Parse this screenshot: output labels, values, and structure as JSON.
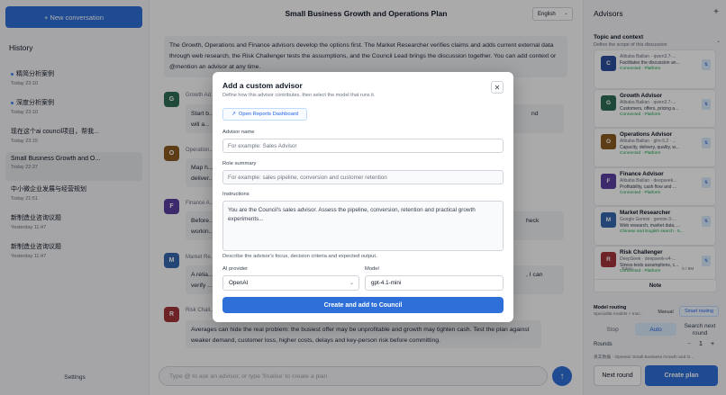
{
  "sidebar": {
    "new_conversation": "+ New conversation",
    "history_title": "History",
    "items": [
      {
        "title": "精简分析案例",
        "time": "Today 23:10",
        "dot": true
      },
      {
        "title": "深度分析案例",
        "time": "Today 23:10",
        "dot": true
      },
      {
        "title": "现在这个ai council项目，帮我...",
        "time": "Today 23:15",
        "dot": false
      },
      {
        "title": "Small Business Growth and O...",
        "time": "Today 22:37",
        "dot": false
      },
      {
        "title": "中小微企业发展与经营规划",
        "time": "Today 21:51",
        "dot": false
      },
      {
        "title": "新制造业咨询议题",
        "time": "Yesterday 11:47",
        "dot": false
      },
      {
        "title": "新制造业咨询议题",
        "time": "Yesterday 11:47",
        "dot": false
      }
    ],
    "settings": "Settings"
  },
  "main": {
    "title": "Small Business Growth and Operations Plan",
    "language": "English",
    "intro": "The Growth, Operations and Finance advisors develop the options first. The Market Researcher verifies claims and adds current external data through web research, the Risk Challenger tests the assumptions, and the Council Lead brings the discussion together. You can add context or @mention an advisor at any time.",
    "messages": [
      {
        "avatar": "G",
        "name": "Growth Ad...",
        "text": "Start b...",
        "text_right": "nd",
        "text2": "will a..."
      },
      {
        "avatar": "O",
        "name": "Operation...",
        "text": "Map h...",
        "text2": "deliver..."
      },
      {
        "avatar": "F",
        "name": "Finance A...",
        "text": "Before...",
        "text_right": "heck",
        "text2": "workin..."
      },
      {
        "avatar": "M",
        "name": "Market Re...",
        "text": "A relia...",
        "text_right": ", I can",
        "text2": "verify ..."
      },
      {
        "avatar": "R",
        "name": "Risk Chall...",
        "text": "Averages can hide the real problem: the busiest offer may be unprofitable and growth may tighten cash. Test the plan against weaker demand, customer loss, higher costs, delays and key-person risk before committing."
      }
    ],
    "input_placeholder": "Type @ to ask an advisor, or type 'finalise' to create a plan"
  },
  "advisors_panel": {
    "title": "Advisors",
    "topic_title": "Topic and context",
    "topic_sub": "Define the scope of this discussion",
    "cards": [
      {
        "avatar": "C",
        "name": "",
        "model": "Alibaba Bailian · qwen3.7-...",
        "desc": "Facilitates the discussion an...",
        "status": "Connected · Platform"
      },
      {
        "avatar": "G",
        "name": "Growth Advisor",
        "model": "Alibaba Bailian · qwen3.7-...",
        "desc": "Customers, offers, pricing a...",
        "status": "Connected · Platform"
      },
      {
        "avatar": "O",
        "name": "Operations Advisor",
        "model": "Alibaba Bailian · glm-5.2 · ...",
        "desc": "Capacity, delivery, quality, w...",
        "status": "Connected · Platform"
      },
      {
        "avatar": "F",
        "name": "Finance Advisor",
        "model": "Alibaba Bailian · deepseek...",
        "desc": "Profitability, cash flow and ...",
        "status": "Connected · Platform"
      },
      {
        "avatar": "M",
        "name": "Market Researcher",
        "model": "Google Gemini · gemini-3-...",
        "desc": "Web research, market data, ...",
        "status": "Chinese and English search · 5..."
      },
      {
        "avatar": "R",
        "name": "Risk Challenger",
        "model": "DeepSeek · deepseek-v4-...",
        "desc": "Stress-tests assumptions, c...",
        "status": "Connected · Platform"
      }
    ],
    "token_label": "Token",
    "token_value": "0 / 8M",
    "note": "Note",
    "model_routing": "Model routing",
    "model_routing_sub": "Specialist models + mar...",
    "manual": "Manual",
    "smart": "Smart routing",
    "stop": "Stop",
    "auto": "Auto",
    "search_next_round": "Search next round",
    "rounds_label": "Rounds",
    "rounds_value": "1",
    "rounds_minus": "−",
    "rounds_plus": "+",
    "source": "真实数据 · Opened: Small Business Growth and O...",
    "next_round": "Next round",
    "create_plan": "Create plan"
  },
  "modal": {
    "title": "Add a custom advisor",
    "subtitle": "Define how this advisor contributes, then select the model that runs it.",
    "open_reports": "Open Reports Dashboard",
    "advisor_name_label": "Advisor name",
    "advisor_name_placeholder": "For example: Sales Advisor",
    "role_summary_label": "Role summary",
    "role_summary_placeholder": "For example: sales pipeline, conversion and customer retention",
    "instructions_label": "Instructions",
    "instructions_value": "You are the Council's sales advisor. Assess the pipeline, conversion, retention and practical growth experiments...",
    "instructions_help": "Describe the advisor's focus, decision criteria and expected output.",
    "provider_label": "AI provider",
    "provider_value": "OpenAI",
    "model_label": "Model",
    "model_value": "gpt-4.1-mini",
    "create_button": "Create and add to Council"
  },
  "colors": {
    "accent": "#2f6fd9",
    "avatar_c": "#2b4f9c",
    "avatar_g": "#2f6e55",
    "avatar_o": "#8a5a1f",
    "avatar_f": "#5b3fa0",
    "avatar_m": "#3468b0",
    "avatar_r": "#a3343a"
  }
}
